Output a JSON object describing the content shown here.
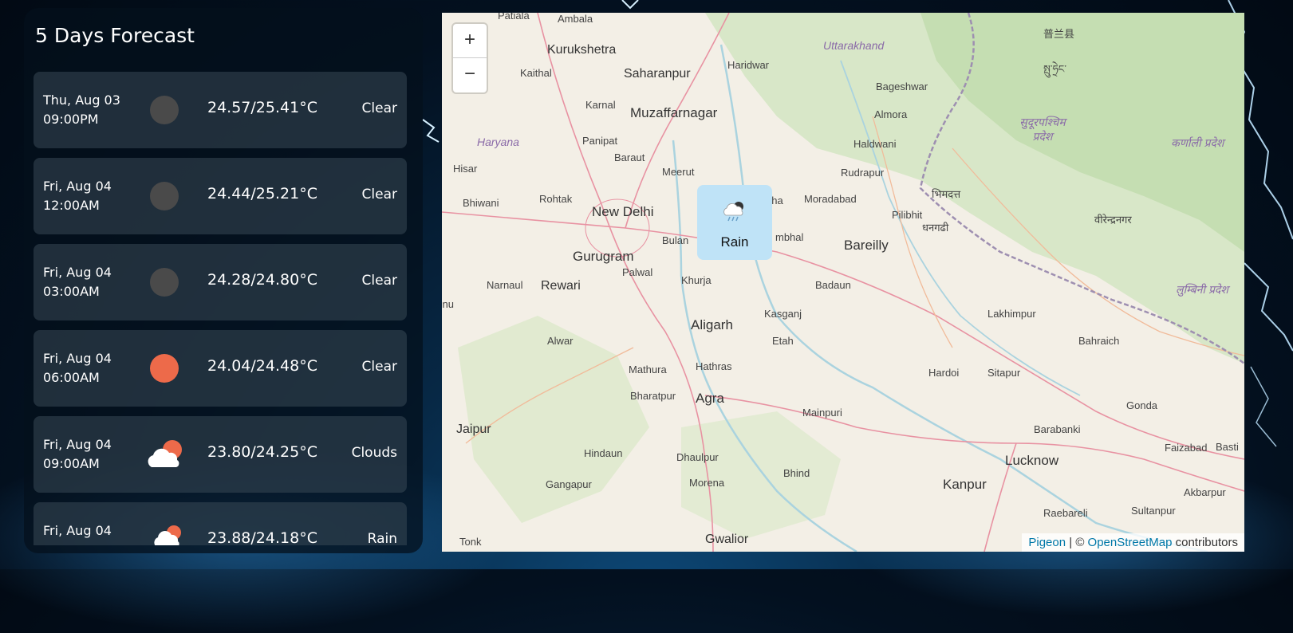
{
  "forecast": {
    "title": "5 Days Forecast",
    "items": [
      {
        "day": "Thu, Aug 03",
        "time": "09:00PM",
        "temp": "24.57/25.41°C",
        "desc": "Clear",
        "icon": "moon-dark-icon"
      },
      {
        "day": "Fri, Aug 04",
        "time": "12:00AM",
        "temp": "24.44/25.21°C",
        "desc": "Clear",
        "icon": "moon-dark-icon"
      },
      {
        "day": "Fri, Aug 04",
        "time": "03:00AM",
        "temp": "24.28/24.80°C",
        "desc": "Clear",
        "icon": "moon-dark-icon"
      },
      {
        "day": "Fri, Aug 04",
        "time": "06:00AM",
        "temp": "24.04/24.48°C",
        "desc": "Clear",
        "icon": "sun-icon"
      },
      {
        "day": "Fri, Aug 04",
        "time": "09:00AM",
        "temp": "23.80/24.25°C",
        "desc": "Clouds",
        "icon": "cloud-sun-icon"
      },
      {
        "day": "Fri, Aug 04",
        "time": "",
        "temp": "23.88/24.18°C",
        "desc": "Rain",
        "icon": "cloud-sun-icon"
      }
    ]
  },
  "map": {
    "zoom_in": "+",
    "zoom_out": "−",
    "popup": {
      "label": "Rain",
      "icon": "rain-cloud-icon"
    },
    "attribution": {
      "provider": "Pigeon",
      "separator": " | © ",
      "osm": "OpenStreetMap",
      "suffix": " contributors"
    },
    "cities": [
      {
        "name": "Patiala"
      },
      {
        "name": "Ambala"
      },
      {
        "name": "Kurukshetra"
      },
      {
        "name": "Kaithal"
      },
      {
        "name": "Saharanpur"
      },
      {
        "name": "Haridwar"
      },
      {
        "name": "Uttarakhand"
      },
      {
        "name": "Karnal"
      },
      {
        "name": "Muzaffarnagar"
      },
      {
        "name": "Bageshwar"
      },
      {
        "name": "Almora"
      },
      {
        "name": "Haryana"
      },
      {
        "name": "Panipat"
      },
      {
        "name": "Baraut"
      },
      {
        "name": "Haldwani"
      },
      {
        "name": "Hisar"
      },
      {
        "name": "Meerut"
      },
      {
        "name": "Rudrapur"
      },
      {
        "name": "Bhiwani"
      },
      {
        "name": "Rohtak"
      },
      {
        "name": "New Delhi"
      },
      {
        "name": "Moradabad"
      },
      {
        "name": "Pilibhit"
      },
      {
        "name": "Bulan"
      },
      {
        "name": "mbhal"
      },
      {
        "name": "Bareilly"
      },
      {
        "name": "Gurugram"
      },
      {
        "name": "Palwal"
      },
      {
        "name": "Narnaul"
      },
      {
        "name": "Rewari"
      },
      {
        "name": "Khurja"
      },
      {
        "name": "Badaun"
      },
      {
        "name": "Kasganj"
      },
      {
        "name": "Lakhimpur"
      },
      {
        "name": "Aligarh"
      },
      {
        "name": "Alwar"
      },
      {
        "name": "Etah"
      },
      {
        "name": "Bahraich"
      },
      {
        "name": "Mathura"
      },
      {
        "name": "Hathras"
      },
      {
        "name": "Hardoi"
      },
      {
        "name": "Sitapur"
      },
      {
        "name": "Bharatpur"
      },
      {
        "name": "Agra"
      },
      {
        "name": "Mainpuri"
      },
      {
        "name": "Gonda"
      },
      {
        "name": "Jaipur"
      },
      {
        "name": "Barabanki"
      },
      {
        "name": "Hindaun"
      },
      {
        "name": "Dhaulpur"
      },
      {
        "name": "Lucknow"
      },
      {
        "name": "Faizabad"
      },
      {
        "name": "Basti"
      },
      {
        "name": "Bhind"
      },
      {
        "name": "Gangapur"
      },
      {
        "name": "Morena"
      },
      {
        "name": "Kanpur"
      },
      {
        "name": "Akbarpur"
      },
      {
        "name": "Raebareli"
      },
      {
        "name": "Sultanpur"
      },
      {
        "name": "Tonk"
      },
      {
        "name": "Gwalior"
      },
      {
        "name": "nunu"
      },
      {
        "name": "oha"
      },
      {
        "name": "सुदूरपश्चिम प्रदेश"
      },
      {
        "name": "कर्णाली प्रदेश"
      },
      {
        "name": "भिमदत्त"
      },
      {
        "name": "धनगढी"
      },
      {
        "name": "वीरेन्द्रनगर"
      },
      {
        "name": "लुम्बिनी प्रदेश"
      },
      {
        "name": "普兰县"
      },
      {
        "name": "སྤུ་ཧྲེང་"
      }
    ]
  },
  "colors": {
    "sun": "#ed6a4a",
    "night": "#4a4a4a",
    "card": "#384856",
    "popup": "#bfe3f7",
    "link": "#0078a8"
  }
}
